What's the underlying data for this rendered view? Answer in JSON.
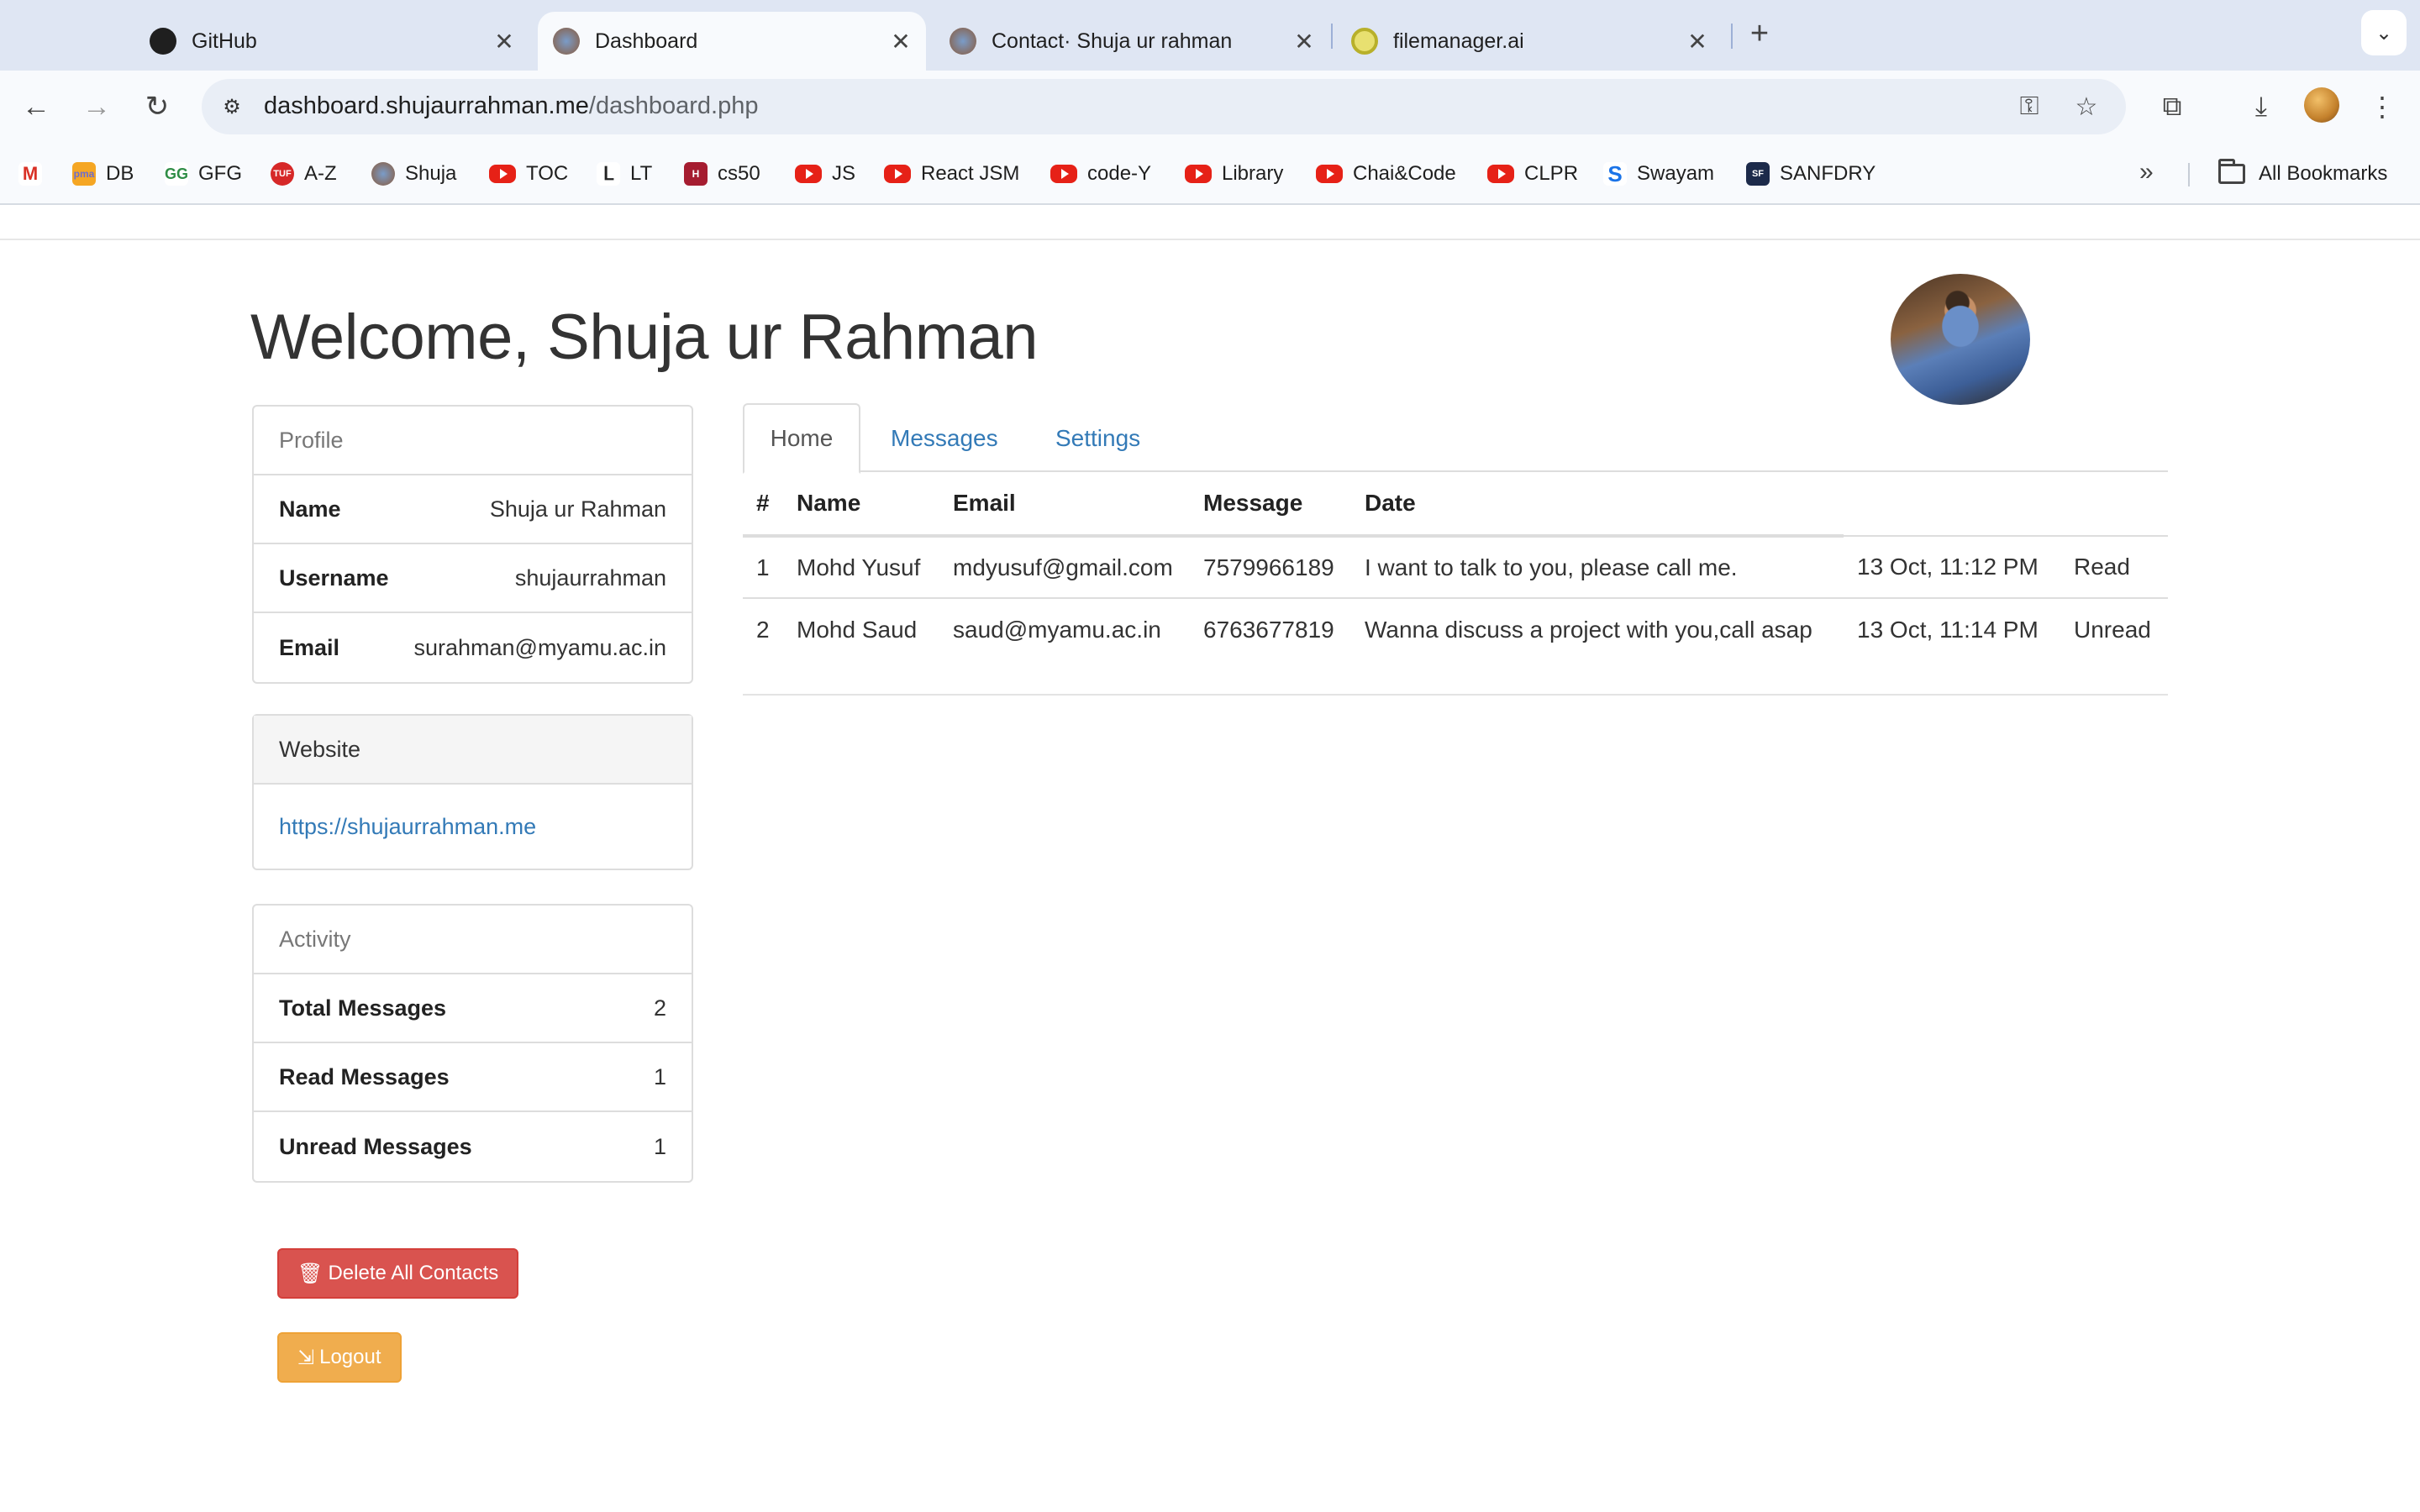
{
  "browser": {
    "tabs": [
      {
        "title": "GitHub",
        "active": false,
        "icon": "github-icon"
      },
      {
        "title": "Dashboard",
        "active": true,
        "icon": "site-icon"
      },
      {
        "title": "Contact· Shuja ur rahman",
        "active": false,
        "icon": "site-icon"
      },
      {
        "title": "filemanager.ai",
        "active": false,
        "icon": "filemanager-icon"
      }
    ],
    "url_host": "dashboard.shujaurrahman.me",
    "url_path": "/dashboard.php",
    "bookmarks": [
      {
        "label": "",
        "icon": "gmail-icon"
      },
      {
        "label": "DB",
        "icon": "pma-icon"
      },
      {
        "label": "GFG",
        "icon": "gfg-icon"
      },
      {
        "label": "A-Z",
        "icon": "tuf-icon"
      },
      {
        "label": "Shuja",
        "icon": "site-icon"
      },
      {
        "label": "TOC",
        "icon": "youtube-icon"
      },
      {
        "label": "LT",
        "icon": "leetcode-icon"
      },
      {
        "label": "cs50",
        "icon": "harvard-icon"
      },
      {
        "label": "JS",
        "icon": "youtube-icon"
      },
      {
        "label": "React JSM",
        "icon": "youtube-icon"
      },
      {
        "label": "code-Y",
        "icon": "youtube-icon"
      },
      {
        "label": "Library",
        "icon": "youtube-icon"
      },
      {
        "label": "Chai&Code",
        "icon": "youtube-icon"
      },
      {
        "label": "CLPR",
        "icon": "youtube-icon"
      },
      {
        "label": "Swayam",
        "icon": "swayam-icon"
      },
      {
        "label": "SANFDRY",
        "icon": "sanfdry-icon"
      }
    ],
    "all_bookmarks": "All Bookmarks"
  },
  "page": {
    "welcome": "Welcome, Shuja ur Rahman",
    "profile": {
      "heading": "Profile",
      "rows": [
        {
          "label": "Name",
          "value": "Shuja ur Rahman"
        },
        {
          "label": "Username",
          "value": "shujaurrahman"
        },
        {
          "label": "Email",
          "value": "surahman@myamu.ac.in"
        }
      ]
    },
    "website": {
      "heading": "Website",
      "link": "https://shujaurrahman.me"
    },
    "activity": {
      "heading": "Activity",
      "rows": [
        {
          "label": "Total Messages",
          "value": "2"
        },
        {
          "label": "Read Messages",
          "value": "1"
        },
        {
          "label": "Unread Messages",
          "value": "1"
        }
      ]
    },
    "buttons": {
      "delete_all": "Delete All Contacts",
      "logout": "Logout"
    },
    "tabs": [
      "Home",
      "Messages",
      "Settings"
    ],
    "table": {
      "headers": [
        "#",
        "Name",
        "Email",
        "Message",
        "Date"
      ],
      "rows": [
        {
          "num": "1",
          "name": "Mohd Yusuf",
          "email": "mdyusuf@gmail.com",
          "phone": "7579966189",
          "message": "I want to talk to you, please call me.",
          "date": "13 Oct, 11:12 PM",
          "status": "Read"
        },
        {
          "num": "2",
          "name": "Mohd Saud",
          "email": "saud@myamu.ac.in",
          "phone": "6763677819",
          "message": "Wanna discuss a project with you,call asap",
          "date": "13 Oct, 11:14 PM",
          "status": "Unread"
        }
      ]
    },
    "colors": {
      "link": "#337ab7",
      "danger": "#d9534f",
      "warning": "#f0ad4e",
      "read": "#3c763d",
      "unread": "#a94442"
    }
  }
}
